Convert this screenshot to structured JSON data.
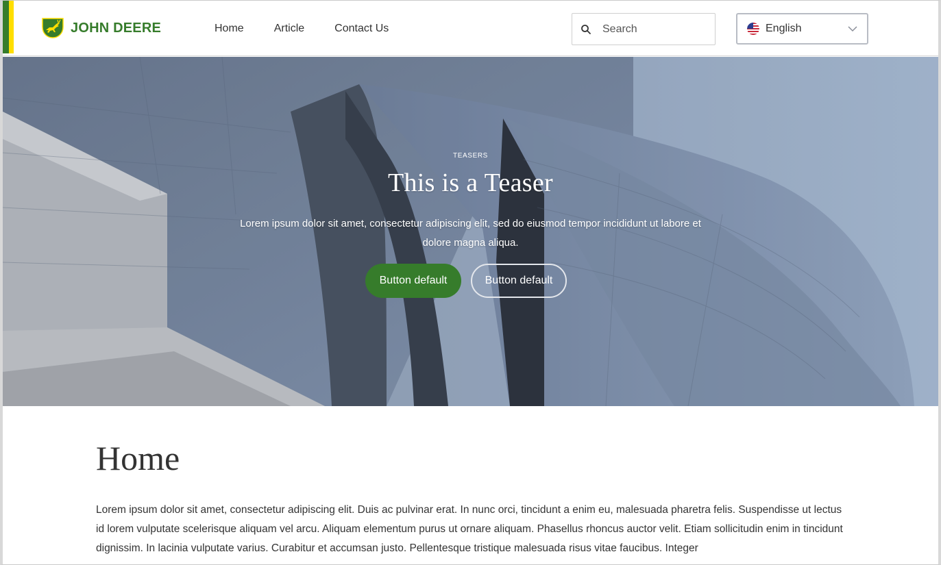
{
  "header": {
    "brand_name": "JOHN DEERE",
    "nav": [
      "Home",
      "Article",
      "Contact Us"
    ],
    "search_placeholder": "Search",
    "language": "English"
  },
  "hero": {
    "eyebrow": "TEASERS",
    "title": "This is a Teaser",
    "text": "Lorem ipsum dolor sit amet, consectetur adipiscing elit, sed do eiusmod tempor incididunt ut labore et dolore magna aliqua.",
    "primary_button": "Button default",
    "secondary_button": "Button default"
  },
  "main": {
    "title": "Home",
    "paragraph": "Lorem ipsum dolor sit amet, consectetur adipiscing elit. Duis ac pulvinar erat. In nunc orci, tincidunt a enim eu, malesuada pharetra felis. Suspendisse ut lectus id lorem vulputate scelerisque aliquam vel arcu. Aliquam elementum purus ut ornare aliquam. Phasellus rhoncus auctor velit. Etiam sollicitudin enim in tincidunt dignissim. In lacinia vulputate varius. Curabitur et accumsan justo. Pellentesque tristique malesuada risus vitae faucibus. Integer"
  },
  "colors": {
    "brand_green": "#367c2b",
    "brand_yellow": "#ffde00"
  },
  "icons": {
    "logo": "leaping-deer-logo-icon",
    "search": "search-icon",
    "flag": "us-flag-icon",
    "dropdown": "chevron-down-icon"
  }
}
